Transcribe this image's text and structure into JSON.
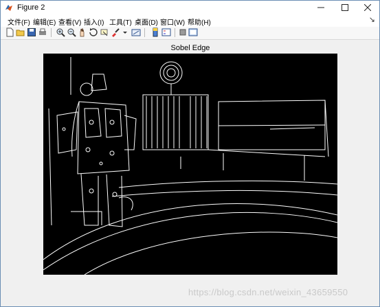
{
  "window": {
    "title": "Figure 2"
  },
  "menu": {
    "items": [
      "文件(F)",
      "编辑(E)",
      "查看(V)",
      "插入(I)",
      "工具(T)",
      "桌面(D)",
      "窗口(W)",
      "帮助(H)"
    ]
  },
  "toolbar": {
    "icons": [
      "new-figure-icon",
      "open-file-icon",
      "save-icon",
      "print-icon",
      "zoom-in-icon",
      "zoom-out-icon",
      "pan-icon",
      "rotate-3d-icon",
      "data-cursor-icon",
      "brush-icon",
      "link-plot-icon",
      "colorbar-icon",
      "legend-icon",
      "hide-plot-tools-icon",
      "show-plot-tools-icon"
    ]
  },
  "axes": {
    "title": "Sobel Edge"
  },
  "watermark": "https://blog.csdn.net/weixin_43659550",
  "colors": {
    "titlebar": "#ffffff",
    "background": "#f0f0f0",
    "image_background": "#000000",
    "edges": "#ffffff"
  }
}
